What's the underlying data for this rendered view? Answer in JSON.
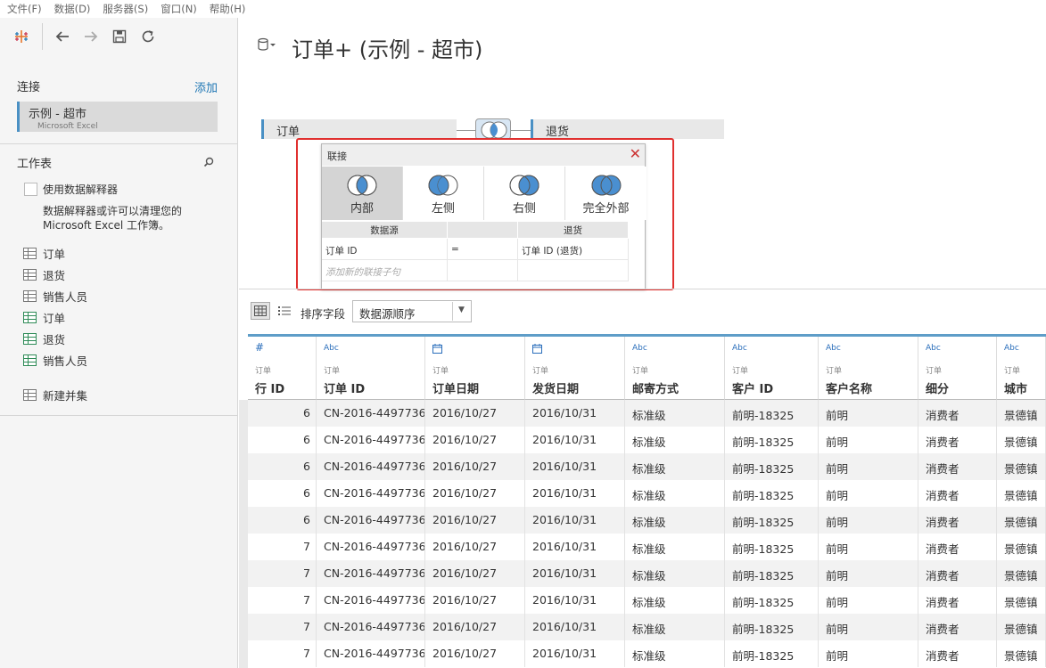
{
  "menu": {
    "file": "文件(F)",
    "data": "数据(D)",
    "server": "服务器(S)",
    "window": "窗口(N)",
    "help": "帮助(H)"
  },
  "left": {
    "connections_title": "连接",
    "add_label": "添加",
    "connection": {
      "name": "示例 - 超市",
      "type": "Microsoft Excel"
    },
    "sheets_title": "工作表",
    "interpreter_label": "使用数据解释器",
    "interpreter_desc": "数据解释器或许可以清理您的 Microsoft Excel 工作簿。",
    "sheets": [
      "订单",
      "退货",
      "销售人员"
    ],
    "named_ranges": [
      "订单",
      "退货",
      "销售人员"
    ],
    "new_union": "新建并集"
  },
  "main": {
    "title": "订单+ (示例 - 超市)",
    "left_table": "订单",
    "right_table": "退货"
  },
  "join_dialog": {
    "title": "联接",
    "types": [
      "内部",
      "左侧",
      "右侧",
      "完全外部"
    ],
    "active_type": "内部",
    "col_left": "数据源",
    "col_right": "退货",
    "clause": {
      "left": "订单 ID",
      "op": "=",
      "right": "订单 ID (退货)"
    },
    "add_placeholder": "添加新的联接子句"
  },
  "data_toolbar": {
    "sort_label": "排序字段",
    "sort_value": "数据源顺序"
  },
  "grid": {
    "columns": [
      {
        "type": "#",
        "source": "订单",
        "name": "行 ID"
      },
      {
        "type": "Abc",
        "source": "订单",
        "name": "订单 ID"
      },
      {
        "type": "date-icon",
        "source": "订单",
        "name": "订单日期"
      },
      {
        "type": "date-icon",
        "source": "订单",
        "name": "发货日期"
      },
      {
        "type": "Abc",
        "source": "订单",
        "name": "邮寄方式"
      },
      {
        "type": "Abc",
        "source": "订单",
        "name": "客户 ID"
      },
      {
        "type": "Abc",
        "source": "订单",
        "name": "客户名称"
      },
      {
        "type": "Abc",
        "source": "订单",
        "name": "细分"
      },
      {
        "type": "Abc",
        "source": "订单",
        "name": "城市"
      }
    ],
    "rows": [
      [
        "6",
        "CN-2016-4497736",
        "2016/10/27",
        "2016/10/31",
        "标准级",
        "前明-18325",
        "前明",
        "消费者",
        "景德镇"
      ],
      [
        "6",
        "CN-2016-4497736",
        "2016/10/27",
        "2016/10/31",
        "标准级",
        "前明-18325",
        "前明",
        "消费者",
        "景德镇"
      ],
      [
        "6",
        "CN-2016-4497736",
        "2016/10/27",
        "2016/10/31",
        "标准级",
        "前明-18325",
        "前明",
        "消费者",
        "景德镇"
      ],
      [
        "6",
        "CN-2016-4497736",
        "2016/10/27",
        "2016/10/31",
        "标准级",
        "前明-18325",
        "前明",
        "消费者",
        "景德镇"
      ],
      [
        "6",
        "CN-2016-4497736",
        "2016/10/27",
        "2016/10/31",
        "标准级",
        "前明-18325",
        "前明",
        "消费者",
        "景德镇"
      ],
      [
        "7",
        "CN-2016-4497736",
        "2016/10/27",
        "2016/10/31",
        "标准级",
        "前明-18325",
        "前明",
        "消费者",
        "景德镇"
      ],
      [
        "7",
        "CN-2016-4497736",
        "2016/10/27",
        "2016/10/31",
        "标准级",
        "前明-18325",
        "前明",
        "消费者",
        "景德镇"
      ],
      [
        "7",
        "CN-2016-4497736",
        "2016/10/27",
        "2016/10/31",
        "标准级",
        "前明-18325",
        "前明",
        "消费者",
        "景德镇"
      ],
      [
        "7",
        "CN-2016-4497736",
        "2016/10/27",
        "2016/10/31",
        "标准级",
        "前明-18325",
        "前明",
        "消费者",
        "景德镇"
      ],
      [
        "7",
        "CN-2016-4497736",
        "2016/10/27",
        "2016/10/31",
        "标准级",
        "前明-18325",
        "前明",
        "消费者",
        "景德镇"
      ]
    ]
  },
  "colors": {
    "accent": "#4a90c4",
    "highlight_box": "#e0302f",
    "venn_fill": "#4a8fd0"
  }
}
